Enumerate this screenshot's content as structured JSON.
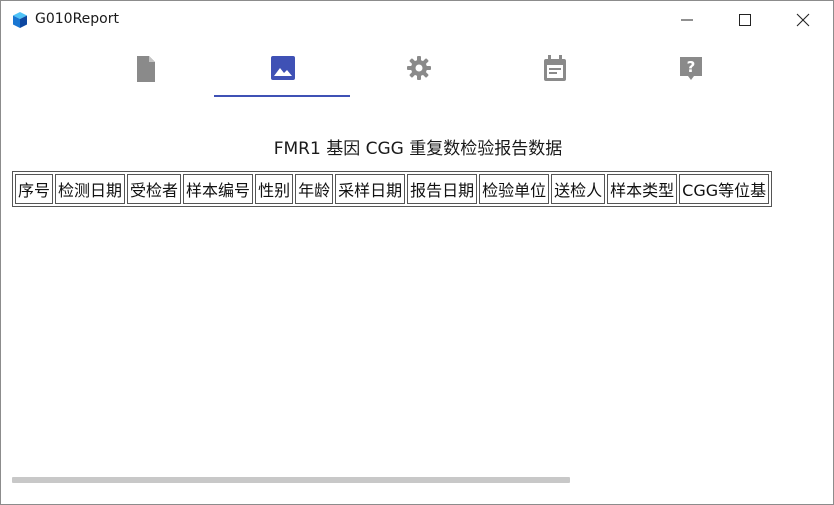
{
  "window": {
    "title": "G010Report",
    "icons": {
      "app": "app-cube-icon",
      "minimize": "minimize-icon",
      "maximize": "maximize-icon",
      "close": "close-icon"
    }
  },
  "tabs": [
    {
      "icon": "document-icon",
      "active": false
    },
    {
      "icon": "image-icon",
      "active": true
    },
    {
      "icon": "settings-gear-icon",
      "active": false
    },
    {
      "icon": "calendar-icon",
      "active": false
    },
    {
      "icon": "help-icon",
      "active": false
    }
  ],
  "colors": {
    "accent": "#3f51b5",
    "tab_icon_inactive": "#8a8a8a",
    "scrollbar": "#c8c8c8"
  },
  "report": {
    "title": "FMR1 基因 CGG 重复数检验报告数据",
    "columns": [
      "序号",
      "检测日期",
      "受检者",
      "样本编号",
      "性别",
      "年龄",
      "采样日期",
      "报告日期",
      "检验单位",
      "送检人",
      "样本类型",
      "CGG等位基"
    ]
  }
}
